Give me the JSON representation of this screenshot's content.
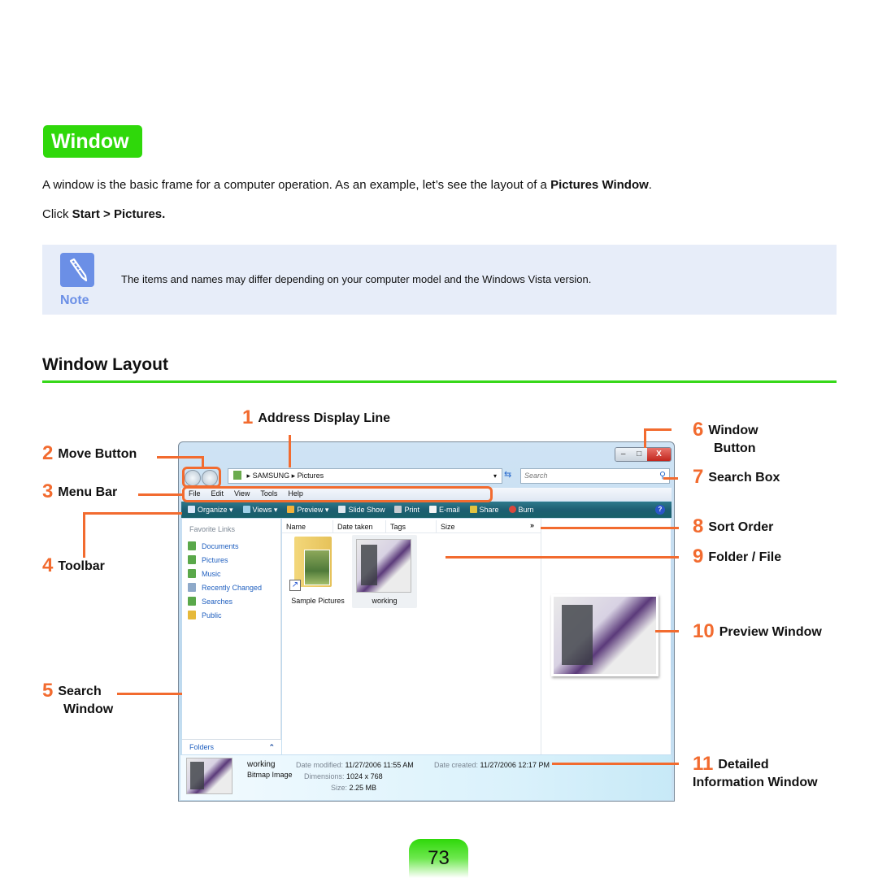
{
  "section": {
    "title": "Window"
  },
  "intro": {
    "text_before": "A window is the basic frame for a computer operation. As an example, let’s see the layout of a ",
    "bold": "Pictures Window",
    "text_after": "."
  },
  "instruction": {
    "prefix": "Click ",
    "path": "Start > Pictures."
  },
  "note": {
    "label": "Note",
    "text": "The items and names may differ depending on your computer model and the Windows Vista version."
  },
  "layout": {
    "heading": "Window Layout"
  },
  "callouts": [
    {
      "num": "1",
      "label": "Address Display Line"
    },
    {
      "num": "2",
      "label": "Move Button"
    },
    {
      "num": "3",
      "label": "Menu Bar"
    },
    {
      "num": "4",
      "label": "Toolbar"
    },
    {
      "num": "5",
      "label": "Search",
      "label2": "Window"
    },
    {
      "num": "6",
      "label": "Window",
      "label2": "Button"
    },
    {
      "num": "7",
      "label": "Search Box"
    },
    {
      "num": "8",
      "label": "Sort Order"
    },
    {
      "num": "9",
      "label": "Folder / File"
    },
    {
      "num": "10",
      "label": "Preview Window"
    },
    {
      "num": "11",
      "label": "Detailed",
      "label2": "Information Window"
    }
  ],
  "explorer": {
    "window_buttons": {
      "minimize": "–",
      "maximize": "□",
      "close": "X"
    },
    "address": {
      "segments": [
        "SAMSUNG",
        "Pictures"
      ],
      "separator": "▸"
    },
    "search_placeholder": "Search",
    "menu": [
      "File",
      "Edit",
      "View",
      "Tools",
      "Help"
    ],
    "toolbar": [
      {
        "label": "Organize ▾",
        "icon": "organize-icon",
        "color": "#d8e6f8"
      },
      {
        "label": "Views ▾",
        "icon": "views-icon",
        "color": "#9fd0e8"
      },
      {
        "label": "Preview ▾",
        "icon": "preview-icon",
        "color": "#f2b13a"
      },
      {
        "label": "Slide Show",
        "icon": "slideshow-icon",
        "color": "#dfe7ef"
      },
      {
        "label": "Print",
        "icon": "print-icon",
        "color": "#c7ccd2"
      },
      {
        "label": "E-mail",
        "icon": "email-icon",
        "color": "#f5f5f5"
      },
      {
        "label": "Share",
        "icon": "share-icon",
        "color": "#e2c340"
      },
      {
        "label": "Burn",
        "icon": "burn-icon",
        "color": "#d9473c"
      }
    ],
    "favorites_title": "Favorite Links",
    "favorites": [
      {
        "label": "Documents",
        "color": "#5aa84a"
      },
      {
        "label": "Pictures",
        "color": "#5aa84a"
      },
      {
        "label": "Music",
        "color": "#5aa84a"
      },
      {
        "label": "Recently Changed",
        "color": "#8ea9c9"
      },
      {
        "label": "Searches",
        "color": "#5aa84a"
      },
      {
        "label": "Public",
        "color": "#e6b93a"
      }
    ],
    "folders_label": "Folders",
    "columns": [
      "Name",
      "Date taken",
      "Tags",
      "Size"
    ],
    "more_columns": "»",
    "items": [
      {
        "label": "Sample Pictures",
        "type": "folder-shortcut"
      },
      {
        "label": "working",
        "type": "image"
      }
    ],
    "details": {
      "name": "working",
      "type": "Bitmap Image",
      "date_modified_label": "Date modified:",
      "date_modified": "11/27/2006 11:55 AM",
      "dimensions_label": "Dimensions:",
      "dimensions": "1024 x 768",
      "size_label": "Size:",
      "size": "2.25 MB",
      "date_created_label": "Date created:",
      "date_created": "11/27/2006 12:17 PM"
    }
  },
  "colors": {
    "accent_green": "#2fd80a",
    "callout_orange": "#f26b2f",
    "note_blue": "#6b8fe6"
  },
  "page_number": "73"
}
